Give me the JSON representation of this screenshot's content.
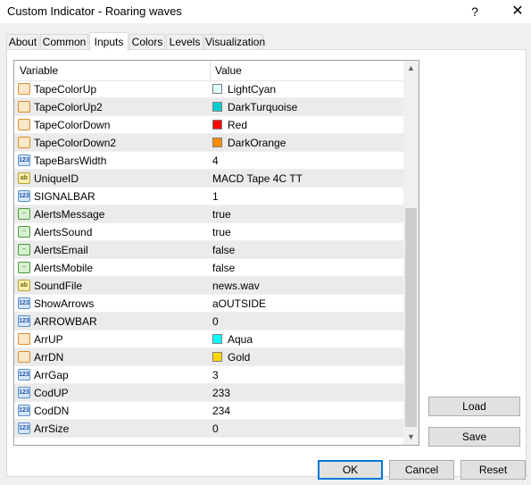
{
  "window": {
    "title": "Custom Indicator - Roaring waves",
    "help_glyph": "?",
    "close_glyph": "✕"
  },
  "tabs": [
    {
      "label": "About"
    },
    {
      "label": "Common"
    },
    {
      "label": "Inputs",
      "active": true
    },
    {
      "label": "Colors"
    },
    {
      "label": "Levels"
    },
    {
      "label": "Visualization"
    }
  ],
  "grid": {
    "header_variable": "Variable",
    "header_value": "Value",
    "rows": [
      {
        "name": "TapeColorUp",
        "value": "LightCyan",
        "type": "color",
        "icon": "color-param-icon",
        "swatch": "#e0ffff"
      },
      {
        "name": "TapeColorUp2",
        "value": "DarkTurquoise",
        "type": "color",
        "icon": "color-param-icon",
        "swatch": "#00ced1"
      },
      {
        "name": "TapeColorDown",
        "value": "Red",
        "type": "color",
        "icon": "color-param-icon",
        "swatch": "#ff0000"
      },
      {
        "name": "TapeColorDown2",
        "value": "DarkOrange",
        "type": "color",
        "icon": "color-param-icon",
        "swatch": "#ff8c00"
      },
      {
        "name": "TapeBarsWidth",
        "value": "4",
        "type": "int",
        "icon": "integer-param-icon"
      },
      {
        "name": "UniqueID",
        "value": "MACD Tape 4C TT",
        "type": "string",
        "icon": "string-param-icon"
      },
      {
        "name": "SIGNALBAR",
        "value": "1",
        "type": "int",
        "icon": "integer-param-icon"
      },
      {
        "name": "AlertsMessage",
        "value": "true",
        "type": "bool",
        "icon": "bool-param-icon"
      },
      {
        "name": "AlertsSound",
        "value": "true",
        "type": "bool",
        "icon": "bool-param-icon"
      },
      {
        "name": "AlertsEmail",
        "value": "false",
        "type": "bool",
        "icon": "bool-param-icon"
      },
      {
        "name": "AlertsMobile",
        "value": "false",
        "type": "bool",
        "icon": "bool-param-icon"
      },
      {
        "name": "SoundFile",
        "value": "news.wav",
        "type": "string",
        "icon": "string-param-icon"
      },
      {
        "name": "ShowArrows",
        "value": "aOUTSIDE",
        "type": "int",
        "icon": "integer-param-icon"
      },
      {
        "name": "ARROWBAR",
        "value": "0",
        "type": "int",
        "icon": "integer-param-icon"
      },
      {
        "name": "ArrUP",
        "value": "Aqua",
        "type": "color",
        "icon": "color-param-icon",
        "swatch": "#00ffff"
      },
      {
        "name": "ArrDN",
        "value": "Gold",
        "type": "color",
        "icon": "color-param-icon",
        "swatch": "#ffd700"
      },
      {
        "name": "ArrGap",
        "value": "3",
        "type": "int",
        "icon": "integer-param-icon"
      },
      {
        "name": "CodUP",
        "value": "233",
        "type": "int",
        "icon": "integer-param-icon"
      },
      {
        "name": "CodDN",
        "value": "234",
        "type": "int",
        "icon": "integer-param-icon"
      },
      {
        "name": "ArrSize",
        "value": "0",
        "type": "int",
        "icon": "integer-param-icon"
      }
    ]
  },
  "buttons": {
    "load": "Load",
    "save": "Save",
    "ok": "OK",
    "cancel": "Cancel",
    "reset": "Reset"
  },
  "colors": {
    "accent": "#0078d7",
    "alt_row": "#ebebeb"
  }
}
